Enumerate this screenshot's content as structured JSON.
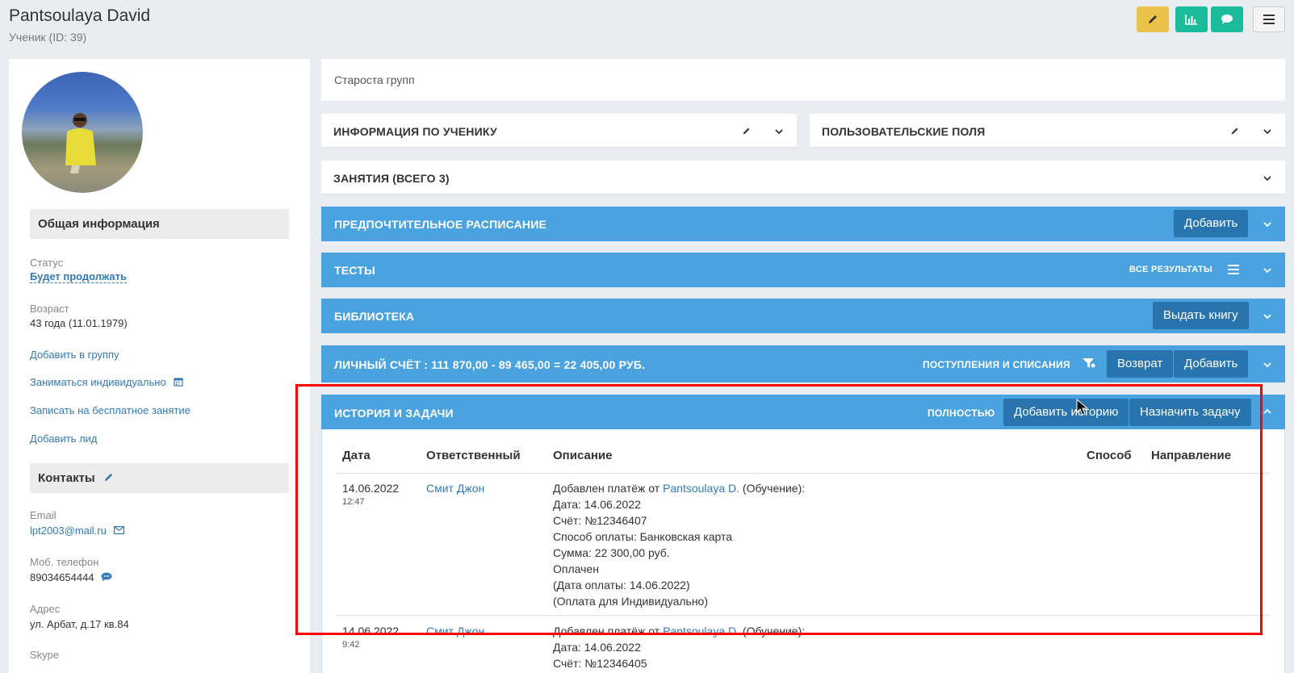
{
  "header": {
    "name": "Pantsoulaya David",
    "subtitle": "Ученик (ID: 39)"
  },
  "top_actions": [
    {
      "icon": "pencil-icon",
      "color": "#eac14a"
    },
    {
      "icon": "bar-chart-icon",
      "color": "#1abc9c"
    },
    {
      "icon": "comment-icon",
      "color": "#1abc9c"
    },
    {
      "icon": "menu-icon",
      "color": "#f4f4f4"
    }
  ],
  "sidebar": {
    "general_title": "Общая информация",
    "status_label": "Статус",
    "status_value": "Будет продолжать",
    "age_label": "Возраст",
    "age_value": "43 года (11.01.1979)",
    "links": [
      "Добавить в группу",
      "Заниматься индивидуально",
      "Записать на бесплатное занятие",
      "Добавить лид"
    ],
    "contacts_title": "Контакты",
    "email_label": "Email",
    "email_value": "lpt2003@mail.ru",
    "phone_label": "Моб. телефон",
    "phone_value": "89034654444",
    "address_label": "Адрес",
    "address_value": "ул. Арбат, д.17 кв.84",
    "skype_label": "Skype"
  },
  "main": {
    "role_text": "Староста групп",
    "panels": {
      "student_info": "ИНФОРМАЦИЯ ПО УЧЕНИКУ",
      "custom_fields": "ПОЛЬЗОВАТЕЛЬСКИЕ ПОЛЯ",
      "lessons": "ЗАНЯТИЯ (ВСЕГО 3)",
      "schedule": "ПРЕДПОЧТИТЕЛЬНОЕ РАСПИСАНИЕ",
      "schedule_btn": "Добавить",
      "tests": "ТЕСТЫ",
      "tests_link": "ВСЕ РЕЗУЛЬТАТЫ",
      "library": "БИБЛИОТЕКА",
      "library_btn": "Выдать книгу",
      "account": "ЛИЧНЫЙ СЧЁТ : 111 870,00 - 89 465,00 = 22 405,00 РУБ.",
      "account_link": "ПОСТУПЛЕНИЯ И СПИСАНИЯ",
      "account_btn_return": "Возврат",
      "account_btn_add": "Добавить",
      "history": "ИСТОРИЯ И ЗАДАЧИ",
      "history_link": "ПОЛНОСТЬЮ",
      "history_btn_add": "Добавить историю",
      "history_btn_task": "Назначить задачу"
    },
    "history_table": {
      "columns": [
        "Дата",
        "Ответственный",
        "Описание",
        "Способ",
        "Направление"
      ],
      "rows": [
        {
          "date": "14.06.2022",
          "time": "12:47",
          "responsible": "Смит Джон",
          "desc_prefix": "Добавлен платёж от ",
          "desc_link": "Pantsoulaya D.",
          "desc_suffix": " (Обучение):",
          "lines": [
            "Дата: 14.06.2022",
            "Счёт: №12346407",
            "Способ оплаты: Банковская карта",
            "Сумма: 22 300,00 руб.",
            "Оплачен",
            "(Дата оплаты: 14.06.2022)",
            "(Оплата для Индивидуально)"
          ]
        },
        {
          "date": "14.06.2022",
          "time": "9:42",
          "responsible": "Смит Джон",
          "desc_prefix": "Добавлен платёж от ",
          "desc_link": "Pantsoulaya D.",
          "desc_suffix": " (Обучение):",
          "lines": [
            "Дата: 14.06.2022",
            "Счёт: №12346405"
          ]
        }
      ]
    }
  },
  "colors": {
    "panel_blue": "#4aa3df",
    "button_dark": "#2874ae",
    "highlight": "#ff0000"
  }
}
